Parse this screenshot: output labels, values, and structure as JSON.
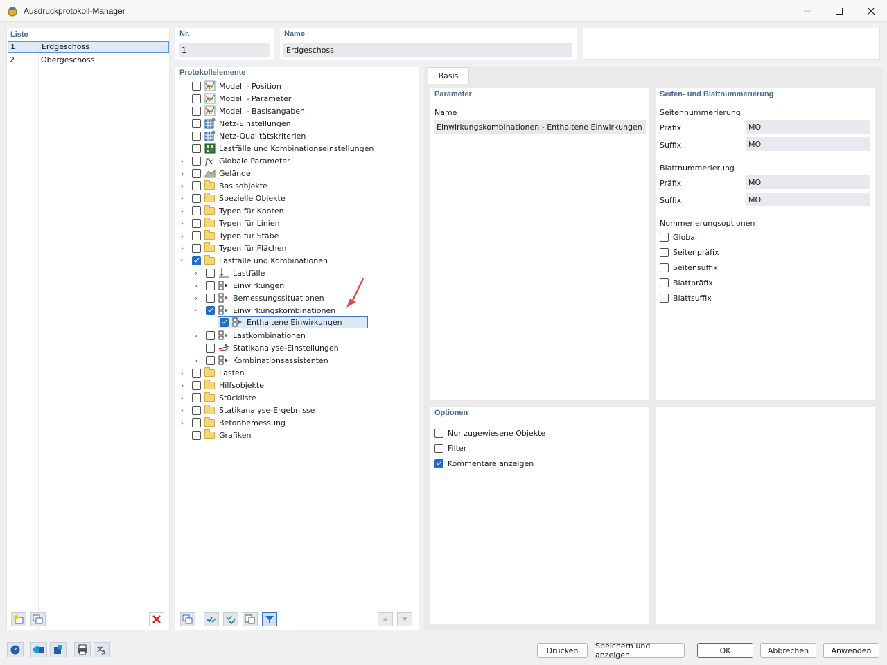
{
  "window": {
    "title": "Ausdruckprotokoll-Manager"
  },
  "list": {
    "label": "Liste",
    "rows": [
      {
        "num": "1",
        "name": "Erdgeschoss"
      },
      {
        "num": "2",
        "name": "Obergeschoss"
      }
    ]
  },
  "header": {
    "nr_label": "Nr.",
    "nr_value": "1",
    "name_label": "Name",
    "name_value": "Erdgeschoss"
  },
  "tree": {
    "label": "Protokollelemente",
    "items": [
      {
        "label": "Modell - Position"
      },
      {
        "label": "Modell - Parameter"
      },
      {
        "label": "Modell - Basisangaben"
      },
      {
        "label": "Netz-Einstellungen"
      },
      {
        "label": "Netz-Qualitätskriterien"
      },
      {
        "label": "Lastfälle und Kombinationseinstellungen"
      },
      {
        "label": "Globale Parameter"
      },
      {
        "label": "Gelände"
      },
      {
        "label": "Basisobjekte"
      },
      {
        "label": "Spezielle Objekte"
      },
      {
        "label": "Typen für Knoten"
      },
      {
        "label": "Typen für Linien"
      },
      {
        "label": "Typen für Stäbe"
      },
      {
        "label": "Typen für Flächen"
      },
      {
        "label": "Lastfälle und Kombinationen"
      },
      {
        "label": "Lastfälle"
      },
      {
        "label": "Einwirkungen"
      },
      {
        "label": "Bemessungssituationen"
      },
      {
        "label": "Einwirkungskombinationen"
      },
      {
        "label": "Enthaltene Einwirkungen"
      },
      {
        "label": "Lastkombinationen"
      },
      {
        "label": "Statikanalyse-Einstellungen"
      },
      {
        "label": "Kombinationsassistenten"
      },
      {
        "label": "Lasten"
      },
      {
        "label": "Hilfsobjekte"
      },
      {
        "label": "Stückliste"
      },
      {
        "label": "Statikanalyse-Ergebnisse"
      },
      {
        "label": "Betonbemessung"
      },
      {
        "label": "Grafiken"
      }
    ]
  },
  "tabs": {
    "basis": "Basis"
  },
  "parameter": {
    "label": "Parameter",
    "name_label": "Name",
    "name_value": "Einwirkungskombinationen - Enthaltene Einwirkungen"
  },
  "numbering": {
    "label": "Seiten- und Blattnummerierung",
    "page_heading": "Seitennummerierung",
    "page_prefix_label": "Präfix",
    "page_prefix_value": "MO",
    "page_suffix_label": "Suffix",
    "page_suffix_value": "MO",
    "sheet_heading": "Blattnummerierung",
    "sheet_prefix_label": "Präfix",
    "sheet_prefix_value": "MO",
    "sheet_suffix_label": "Suffix",
    "sheet_suffix_value": "MO",
    "options_heading": "Nummerierungsoptionen",
    "options": [
      "Global",
      "Seitenpräfix",
      "Seitensuffix",
      "Blattpräfix",
      "Blattsuffix"
    ]
  },
  "options": {
    "label": "Optionen",
    "items": [
      "Nur zugewiesene Objekte",
      "Filter",
      "Kommentare anzeigen"
    ]
  },
  "footer": {
    "print": "Drucken",
    "save_show": "Speichern und anzeigen",
    "ok": "OK",
    "cancel": "Abbrechen",
    "apply": "Anwenden"
  }
}
